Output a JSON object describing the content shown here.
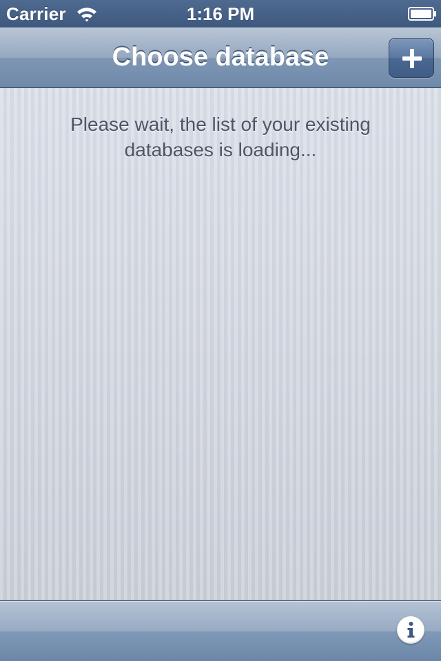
{
  "status_bar": {
    "carrier": "Carrier",
    "time": "1:16 PM",
    "wifi_icon": "wifi-icon",
    "battery_icon": "battery-icon"
  },
  "nav_bar": {
    "title": "Choose database",
    "add_button_icon": "plus-icon"
  },
  "content": {
    "loading_message": "Please wait, the list of your existing databases is loading..."
  },
  "toolbar": {
    "info_button_icon": "info-icon"
  },
  "colors": {
    "status_bar": "#44608a",
    "nav_bar_top": "#b9c6d6",
    "nav_bar_bottom": "#6f89aa",
    "content_background": "#d5dae3",
    "message_text": "#4d5566"
  }
}
